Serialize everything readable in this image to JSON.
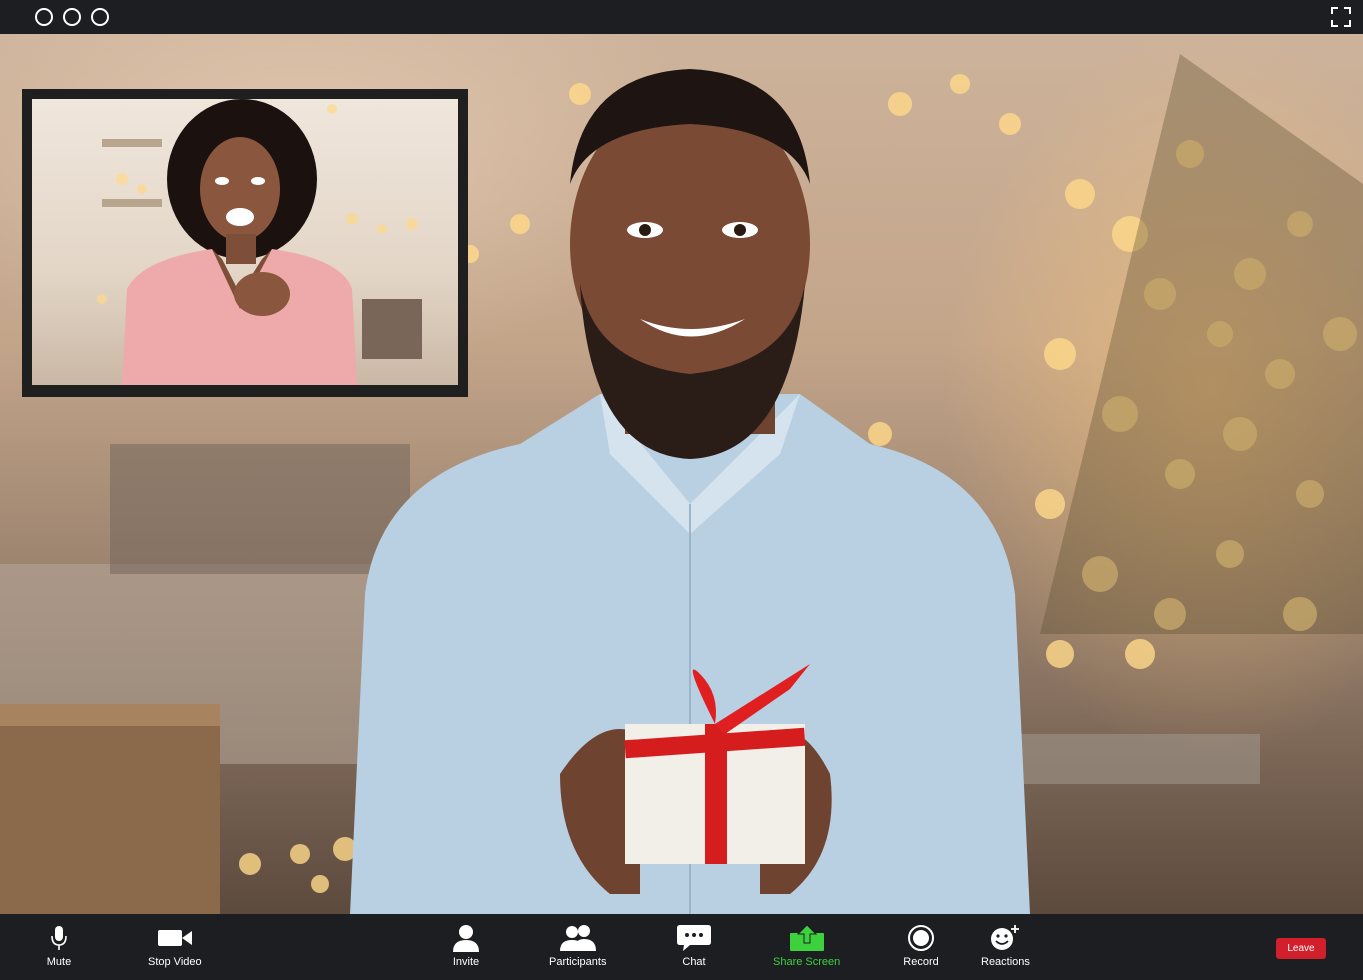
{
  "window": {
    "controls": [
      "window-control",
      "window-control",
      "window-control"
    ]
  },
  "colors": {
    "toolbar_bg": "#1c1e22",
    "leave_red": "#d11f2b",
    "share_green": "#3dd13d"
  },
  "toolbar": {
    "items": [
      {
        "id": "mute",
        "label": "Mute",
        "icon": "microphone-icon"
      },
      {
        "id": "stop-video",
        "label": "Stop Video",
        "icon": "video-camera-icon"
      },
      {
        "id": "invite",
        "label": "Invite",
        "icon": "user-icon"
      },
      {
        "id": "participants",
        "label": "Participants",
        "icon": "users-icon"
      },
      {
        "id": "chat",
        "label": "Chat",
        "icon": "chat-bubble-icon"
      },
      {
        "id": "share-screen",
        "label": "Share Screen",
        "icon": "share-screen-icon"
      },
      {
        "id": "record",
        "label": "Record",
        "icon": "record-icon"
      },
      {
        "id": "reactions",
        "label": "Reactions",
        "icon": "smiley-add-icon"
      }
    ],
    "leave_label": "Leave"
  }
}
